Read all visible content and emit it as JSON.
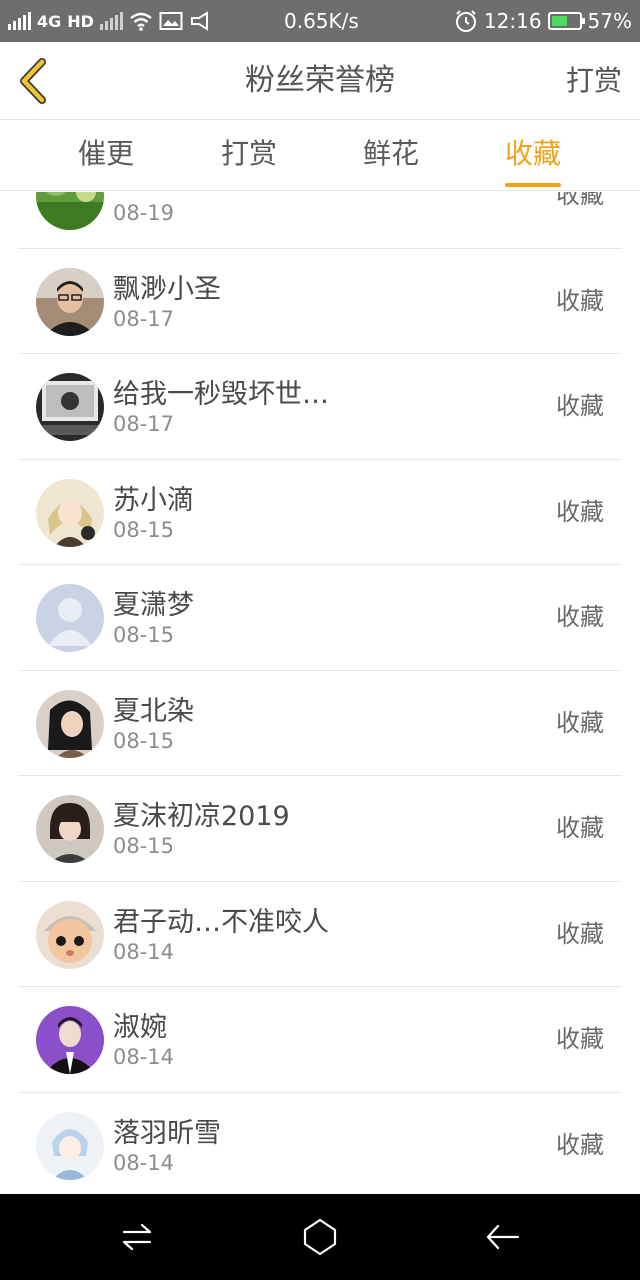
{
  "status_bar": {
    "network": "4G",
    "hd": "HD",
    "speed": "0.65K/s",
    "time": "12:16",
    "battery_percent": "57%",
    "battery_level": 0.57,
    "icons": [
      "signal-icon",
      "signal-no-sim-icon",
      "wifi-icon",
      "image-icon",
      "cast-icon",
      "alarm-icon",
      "battery-icon"
    ]
  },
  "header": {
    "title": "粉丝荣誉榜",
    "right_action": "打赏",
    "back_icon": "back-chevron-icon"
  },
  "tabs": [
    {
      "label": "催更",
      "active": false
    },
    {
      "label": "打赏",
      "active": false
    },
    {
      "label": "鲜花",
      "active": false
    },
    {
      "label": "收藏",
      "active": true
    }
  ],
  "colors": {
    "accent": "#f0a31a",
    "status_bar": "#6e6e6e",
    "text": "#4a4a4a",
    "subtext": "#8c8c8c"
  },
  "list": [
    {
      "name": "",
      "date": "08-19",
      "action": "收藏",
      "avatar": "green-nature"
    },
    {
      "name": "飘渺小圣",
      "date": "08-17",
      "action": "收藏",
      "avatar": "man-glasses"
    },
    {
      "name": "给我一秒毁坏世…",
      "date": "08-17",
      "action": "收藏",
      "avatar": "bw-photo"
    },
    {
      "name": "苏小滴",
      "date": "08-15",
      "action": "收藏",
      "avatar": "anime-girl"
    },
    {
      "name": "夏潇梦",
      "date": "08-15",
      "action": "收藏",
      "avatar": "default-avatar"
    },
    {
      "name": "夏北染",
      "date": "08-15",
      "action": "收藏",
      "avatar": "girl-dark-hair"
    },
    {
      "name": "夏沫初凉2019",
      "date": "08-15",
      "action": "收藏",
      "avatar": "girl-bob"
    },
    {
      "name": "君子动…不准咬人",
      "date": "08-14",
      "action": "收藏",
      "avatar": "cartoon-doll"
    },
    {
      "name": "淑婉",
      "date": "08-14",
      "action": "收藏",
      "avatar": "man-suit-purple"
    },
    {
      "name": "落羽昕雪",
      "date": "08-14",
      "action": "收藏",
      "avatar": "anime-boy-blue"
    }
  ],
  "nav_bar": {
    "icons": [
      "menu-swap-icon",
      "home-icon",
      "back-arrow-icon"
    ]
  }
}
